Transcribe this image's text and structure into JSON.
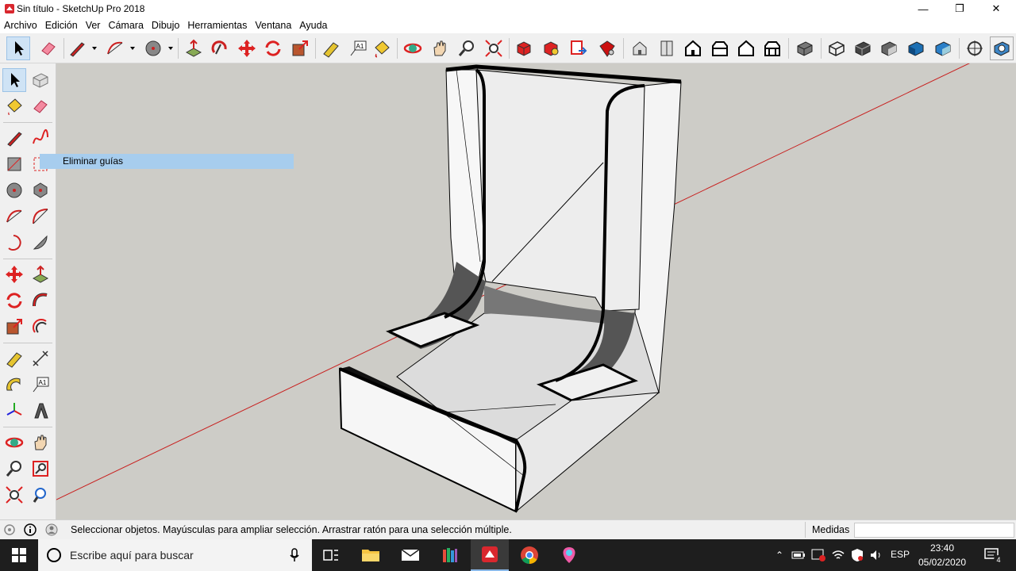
{
  "window": {
    "title": "Sin título - SketchUp Pro 2018",
    "minimize": "—",
    "restore": "❐",
    "close": "✕"
  },
  "menu": [
    "Archivo",
    "Edición",
    "Ver",
    "Cámara",
    "Dibujo",
    "Herramientas",
    "Ventana",
    "Ayuda"
  ],
  "toolbar": {
    "icons": [
      "select-icon",
      "eraser-icon",
      "pencil-line-icon",
      "arc-icon",
      "circle-icon",
      "push-pull-icon",
      "rotate-icon",
      "move-icon",
      "rotate-arrows-icon",
      "scale-icon",
      "tape-measure-icon",
      "text-icon",
      "paint-bucket-icon",
      "orbit-icon",
      "pan-icon",
      "zoom-icon",
      "zoom-extents-icon",
      "warehouse-icon",
      "extension-warehouse-icon",
      "layout-send-icon",
      "extension-manager-icon",
      "iso-view-icon",
      "top-view-icon",
      "front-view-icon",
      "right-view-icon",
      "back-view-icon",
      "left-view-icon",
      "xray-style-icon",
      "wireframe-style-icon",
      "hidden-line-style-icon",
      "shaded-style-icon",
      "shaded-textures-style-icon",
      "monochrome-style-icon",
      "section-plane-icon",
      "show-section-icon"
    ]
  },
  "tooltip": "Eliminar guías",
  "status": {
    "message": "Seleccionar objetos. Mayúsculas para ampliar selección. Arrastrar ratón para una selección múltiple.",
    "measures_label": "Medidas",
    "measures_value": ""
  },
  "taskbar": {
    "search_placeholder": "Escribe aquí para buscar",
    "language": "ESP",
    "time": "23:40",
    "date": "05/02/2020",
    "notifications": "4"
  },
  "colors": {
    "viewport_bg": "#cdccc7",
    "red_axis": "#c8201f",
    "selection_blue": "#cfe3f5",
    "tooltip_bg": "#a7cdee",
    "taskbar_bg": "#1e1e1e"
  }
}
